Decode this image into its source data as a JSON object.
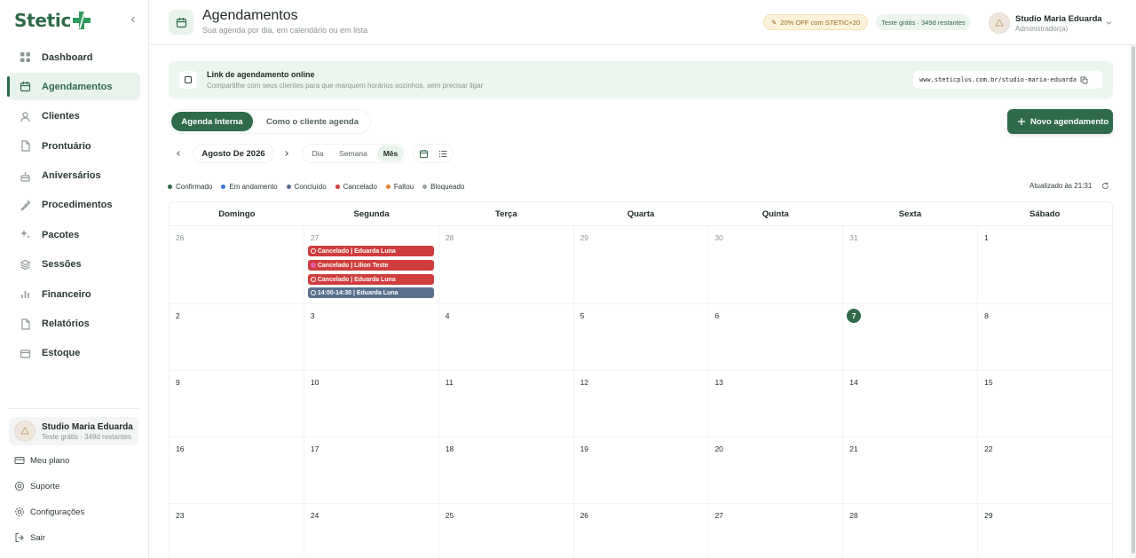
{
  "app": {
    "logo_text": "Stetic"
  },
  "sidebar": {
    "items": [
      {
        "label": "Dashboard",
        "icon": "grid-icon"
      },
      {
        "label": "Agendamentos",
        "icon": "calendar-icon",
        "active": true
      },
      {
        "label": "Clientes",
        "icon": "user-icon"
      },
      {
        "label": "Prontuário",
        "icon": "file-icon"
      },
      {
        "label": "Aniversários",
        "icon": "cake-icon"
      },
      {
        "label": "Procedimentos",
        "icon": "syringe-icon"
      },
      {
        "label": "Pacotes",
        "icon": "sparkles-icon"
      },
      {
        "label": "Sessões",
        "icon": "layers-icon"
      },
      {
        "label": "Financeiro",
        "icon": "bar-chart-icon"
      },
      {
        "label": "Relatórios",
        "icon": "file-icon"
      },
      {
        "label": "Estoque",
        "icon": "box-icon"
      }
    ],
    "studio": {
      "name": "Studio Maria Eduarda",
      "sub": "Teste grátis · 349d restantes"
    },
    "links": {
      "plan": "Meu plano",
      "support": "Suporte",
      "settings": "Configurações",
      "logout": "Sair"
    }
  },
  "header": {
    "title": "Agendamentos",
    "subtitle": "Sua agenda por dia, em calendário ou em lista",
    "promo": "20% OFF com STETIC+20",
    "trial": "Teste grátis · 349d restantes",
    "user_name": "Studio Maria Eduarda",
    "user_role": "Administrador(a)"
  },
  "banner": {
    "title": "Link de agendamento online",
    "subtitle": "Compartilhe com seus clientes para que marquem horários sozinhos, sem precisar ligar",
    "url": "www.steticplus.com.br/studio-maria-eduarda"
  },
  "toggles": {
    "internal": "Agenda Interna",
    "client": "Como o cliente agenda"
  },
  "new_button": "Novo agendamento",
  "calendar": {
    "month_label": "Agosto De 2026",
    "views": {
      "day": "Dia",
      "week": "Semana",
      "month": "Mês"
    },
    "legend": [
      {
        "label": "Confirmado",
        "color": "#2f6b4a"
      },
      {
        "label": "Em andamento",
        "color": "#3a7bd5"
      },
      {
        "label": "Concluído",
        "color": "#5a6f8e"
      },
      {
        "label": "Cancelado",
        "color": "#cf3d3d"
      },
      {
        "label": "Faltou",
        "color": "#e8832a"
      },
      {
        "label": "Bloqueado",
        "color": "#9aa3a0"
      }
    ],
    "updated": "Atualizado às 21:31",
    "weekdays": [
      "Domingo",
      "Segunda",
      "Terça",
      "Quarta",
      "Quinta",
      "Sexta",
      "Sábado"
    ],
    "weeks": [
      [
        "26",
        "27",
        "28",
        "29",
        "30",
        "31",
        "1"
      ],
      [
        "2",
        "3",
        "4",
        "5",
        "6",
        "7",
        "8"
      ],
      [
        "9",
        "10",
        "11",
        "12",
        "13",
        "14",
        "15"
      ],
      [
        "16",
        "17",
        "18",
        "19",
        "20",
        "21",
        "22"
      ],
      [
        "23",
        "24",
        "25",
        "26",
        "27",
        "28",
        "29"
      ]
    ],
    "today": "7",
    "events": [
      {
        "label": "Cancelado | Eduarda Luna",
        "status": "cancel"
      },
      {
        "label": "Cancelado | Lilion Teste",
        "status": "cancel"
      },
      {
        "label": "Cancelado | Eduarda Luna",
        "status": "cancel"
      },
      {
        "label": "14:00-14:30 | Eduarda Luna",
        "status": "other"
      }
    ]
  }
}
